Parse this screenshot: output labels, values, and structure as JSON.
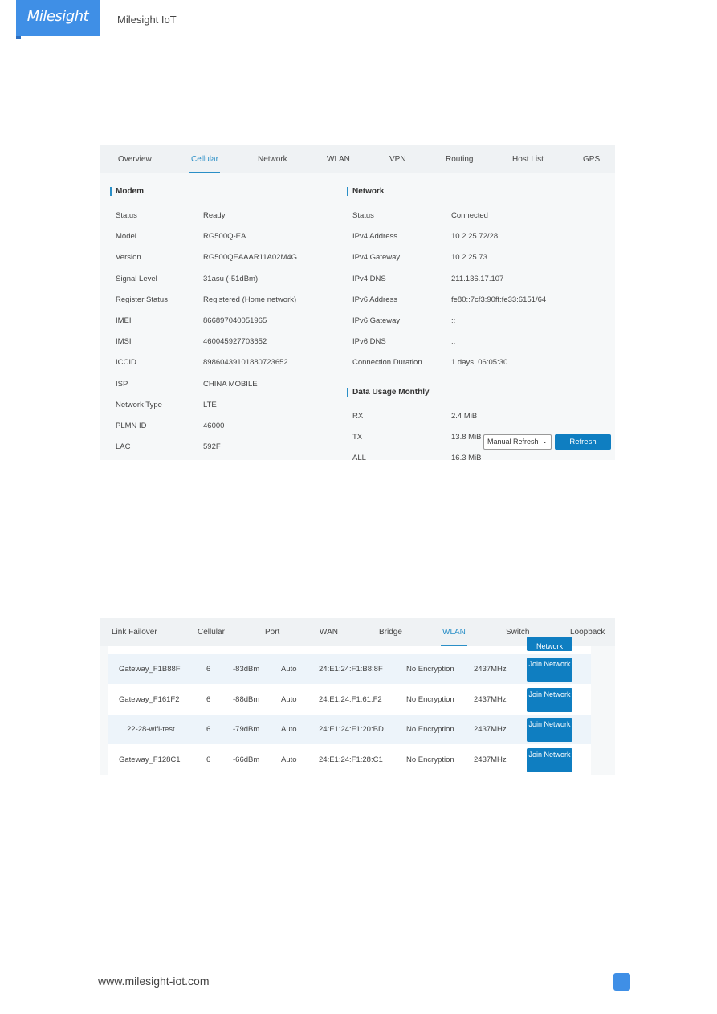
{
  "header": {
    "logo": "Milesight",
    "brand": "Milesight IoT"
  },
  "screenshot1": {
    "tabs": [
      "Overview",
      "Cellular",
      "Network",
      "WLAN",
      "VPN",
      "Routing",
      "Host List",
      "GPS"
    ],
    "active_tab": "Cellular",
    "modem": {
      "title": "Modem",
      "rows": [
        {
          "label": "Status",
          "value": "Ready"
        },
        {
          "label": "Model",
          "value": "RG500Q-EA"
        },
        {
          "label": "Version",
          "value": "RG500QEAAAR11A02M4G"
        },
        {
          "label": "Signal Level",
          "value": "31asu (-51dBm)"
        },
        {
          "label": "Register Status",
          "value": "Registered (Home network)"
        },
        {
          "label": "IMEI",
          "value": "866897040051965"
        },
        {
          "label": "IMSI",
          "value": "460045927703652"
        },
        {
          "label": "ICCID",
          "value": "89860439101880723652"
        },
        {
          "label": "ISP",
          "value": "CHINA MOBILE"
        },
        {
          "label": "Network Type",
          "value": "LTE"
        },
        {
          "label": "PLMN ID",
          "value": "46000"
        },
        {
          "label": "LAC",
          "value": "592F"
        }
      ]
    },
    "network": {
      "title": "Network",
      "rows": [
        {
          "label": "Status",
          "value": "Connected"
        },
        {
          "label": "IPv4 Address",
          "value": "10.2.25.72/28"
        },
        {
          "label": "IPv4 Gateway",
          "value": "10.2.25.73"
        },
        {
          "label": "IPv4 DNS",
          "value": "211.136.17.107"
        },
        {
          "label": "IPv6 Address",
          "value": "fe80::7cf3:90ff:fe33:6151/64"
        },
        {
          "label": "IPv6 Gateway",
          "value": "::"
        },
        {
          "label": "IPv6 DNS",
          "value": "::"
        },
        {
          "label": "Connection Duration",
          "value": "1 days, 06:05:30"
        }
      ]
    },
    "data_usage": {
      "title": "Data Usage Monthly",
      "rows": [
        {
          "label": "RX",
          "value": "2.4 MiB"
        },
        {
          "label": "TX",
          "value": "13.8 MiB"
        },
        {
          "label": "ALL",
          "value": "16.3 MiB"
        }
      ]
    },
    "refresh_select": "Manual Refresh",
    "refresh_button": "Refresh"
  },
  "screenshot2": {
    "tabs": [
      "Link Failover",
      "Cellular",
      "Port",
      "WAN",
      "Bridge",
      "WLAN",
      "Switch",
      "Loopback"
    ],
    "active_tab": "WLAN",
    "partial_button": "Network",
    "rows": [
      {
        "ssid": "Gateway_F1B88F",
        "channel": "6",
        "signal": "-83dBm",
        "mode": "Auto",
        "bssid": "24:E1:24:F1:B8:8F",
        "encryption": "No Encryption",
        "frequency": "2437MHz",
        "action": "Join Network"
      },
      {
        "ssid": "Gateway_F161F2",
        "channel": "6",
        "signal": "-88dBm",
        "mode": "Auto",
        "bssid": "24:E1:24:F1:61:F2",
        "encryption": "No Encryption",
        "frequency": "2437MHz",
        "action": "Join Network"
      },
      {
        "ssid": "22-28-wifi-test",
        "channel": "6",
        "signal": "-79dBm",
        "mode": "Auto",
        "bssid": "24:E1:24:F1:20:BD",
        "encryption": "No Encryption",
        "frequency": "2437MHz",
        "action": "Join Network"
      },
      {
        "ssid": "Gateway_F128C1",
        "channel": "6",
        "signal": "-66dBm",
        "mode": "Auto",
        "bssid": "24:E1:24:F1:28:C1",
        "encryption": "No Encryption",
        "frequency": "2437MHz",
        "action": "Join Network"
      }
    ]
  },
  "footer": {
    "url": "www.milesight-iot.com"
  }
}
